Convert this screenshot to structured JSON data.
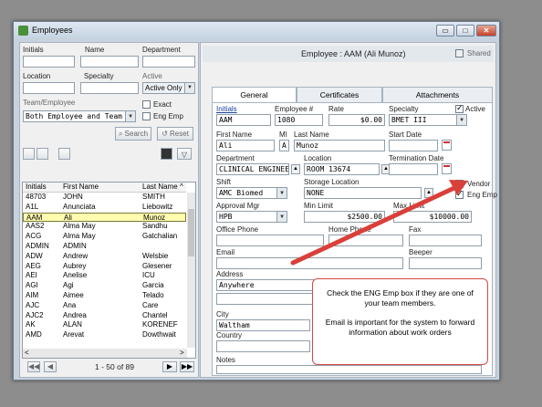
{
  "window": {
    "title": "Employees",
    "btn_min": "▭",
    "btn_max": "□",
    "btn_close": "✕"
  },
  "filters": {
    "initials_label": "Initials",
    "name_label": "Name",
    "department_label": "Department",
    "location_label": "Location",
    "specialty_label": "Specialty",
    "active_label": "Active",
    "active_value": "Active Only",
    "team_label": "Team/Employee",
    "team_value": "Both Employee and Team",
    "exact_label": "Exact",
    "eng_emp_label": "Eng Emp",
    "search_label": "Search",
    "reset_label": "Reset"
  },
  "grid": {
    "headers": [
      "Initials",
      "First Name",
      "Last Name"
    ],
    "rows": [
      [
        "48703",
        "JOHN",
        "SMITH"
      ],
      [
        "A1L",
        "Anunciata",
        "Liebowitz"
      ],
      [
        "AAM",
        "Ali",
        "Munoz"
      ],
      [
        "AAS2",
        "Alma May",
        "Sandhu"
      ],
      [
        "ACG",
        "Alma May",
        "Gatchalian"
      ],
      [
        "ADMIN",
        "ADMIN",
        ""
      ],
      [
        "ADW",
        "Andrew",
        "Welsbie"
      ],
      [
        "AEG",
        "Aubrey",
        "Glesener"
      ],
      [
        "AEI",
        "Anelise",
        "ICU"
      ],
      [
        "AGI",
        "Agi",
        "Garcia"
      ],
      [
        "AIM",
        "Aimee",
        "Telado"
      ],
      [
        "AJC",
        "Ana",
        "Care"
      ],
      [
        "AJC2",
        "Andrea",
        "Chantel"
      ],
      [
        "AK",
        "ALAN",
        "KORENEF"
      ],
      [
        "AMD",
        "Arevat",
        "Dowthwait"
      ]
    ],
    "selected_index": 2,
    "pager": "1 - 50 of 89"
  },
  "employee": {
    "header": "Employee : AAM (Ali Munoz)",
    "shared_label": "Shared",
    "tabs": [
      "General",
      "Certificates",
      "Attachments"
    ],
    "initials_label": "Initials",
    "emp_no_label": "Employee #",
    "rate_label": "Rate",
    "specialty_label": "Specialty",
    "active_label": "Active",
    "initials": "AAM",
    "emp_no": "1080",
    "rate": "$0.00",
    "specialty": "BMET III",
    "first_label": "First Name",
    "mi_label": "MI",
    "last_label": "Last Name",
    "start_label": "Start Date",
    "first": "Ali",
    "mi": "A",
    "last": "Munoz",
    "dept_label": "Department",
    "loc_label": "Location",
    "term_label": "Termination Date",
    "dept": "CLINICAL ENGINEE",
    "loc": "ROOM 13674",
    "shift_label": "Shift",
    "storage_label": "Storage Location",
    "vendor_label": "Vendor",
    "shift": "AMC Biomed",
    "storage": "NONE",
    "eng_emp_label": "Eng Emp",
    "approval_label": "Approval Mgr",
    "min_label": "Min Limit",
    "max_label": "Max Limit",
    "approval": "HPB",
    "min": "$2500.00",
    "max": "$10000.00",
    "office_label": "Office Phone",
    "home_label": "Home Phone",
    "fax_label": "Fax",
    "email_label": "Email",
    "beeper_label": "Beeper",
    "address_label": "Address",
    "address": "Anywhere",
    "city_label": "City",
    "city": "Waltham",
    "country_label": "Country",
    "notes_label": "Notes"
  },
  "callout": {
    "line1": "Check the ENG Emp box if they are one of your team members.",
    "line2": "Email is important for the system to forward information about work orders"
  },
  "colors": {
    "arrow": "#d9403a",
    "selected_row": "#fffcb0"
  }
}
